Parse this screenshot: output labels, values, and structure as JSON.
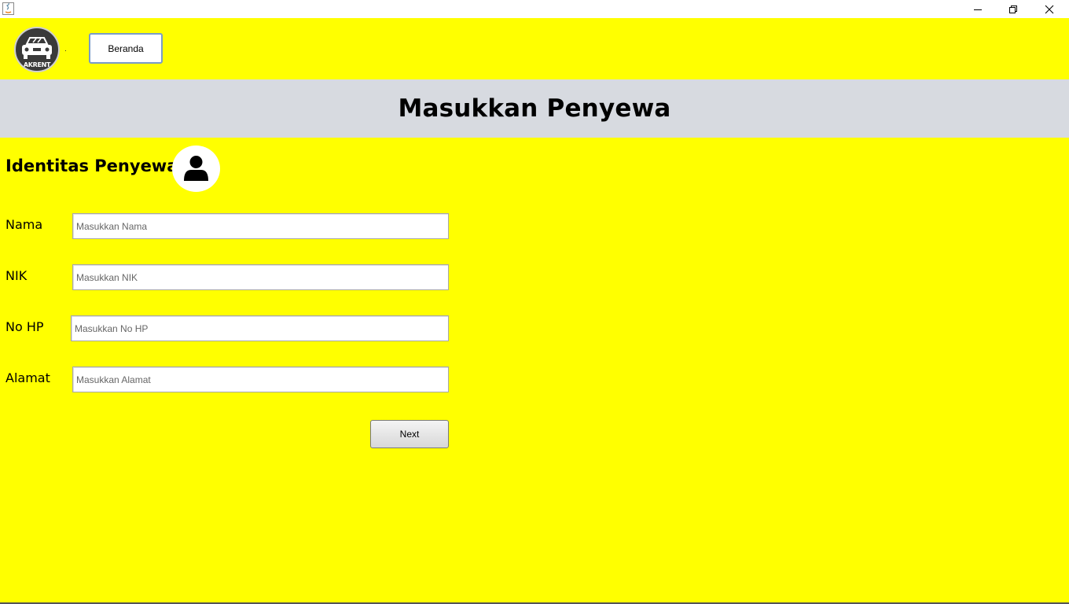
{
  "window": {
    "app_icon": "java-icon",
    "controls": [
      "minimize-icon",
      "maximize-icon",
      "close-icon"
    ]
  },
  "header": {
    "logo_text": "AKRENT",
    "dot": ".",
    "beranda_label": "Beranda"
  },
  "banner": {
    "title": "Masukkan Penyewa"
  },
  "section": {
    "title": "Identitas Penyewa",
    "icon": "user-icon"
  },
  "form": {
    "fields": [
      {
        "label": "Nama",
        "placeholder": "Masukkan Nama"
      },
      {
        "label": "NIK",
        "placeholder": "Masukkan NIK"
      },
      {
        "label": "No HP",
        "placeholder": "Masukkan No HP"
      },
      {
        "label": "Alamat",
        "placeholder": "Masukkan Alamat"
      }
    ],
    "next_label": "Next"
  },
  "colors": {
    "background": "#ffff00",
    "banner": "#d7dae0",
    "button_border": "#7a9cc8"
  }
}
